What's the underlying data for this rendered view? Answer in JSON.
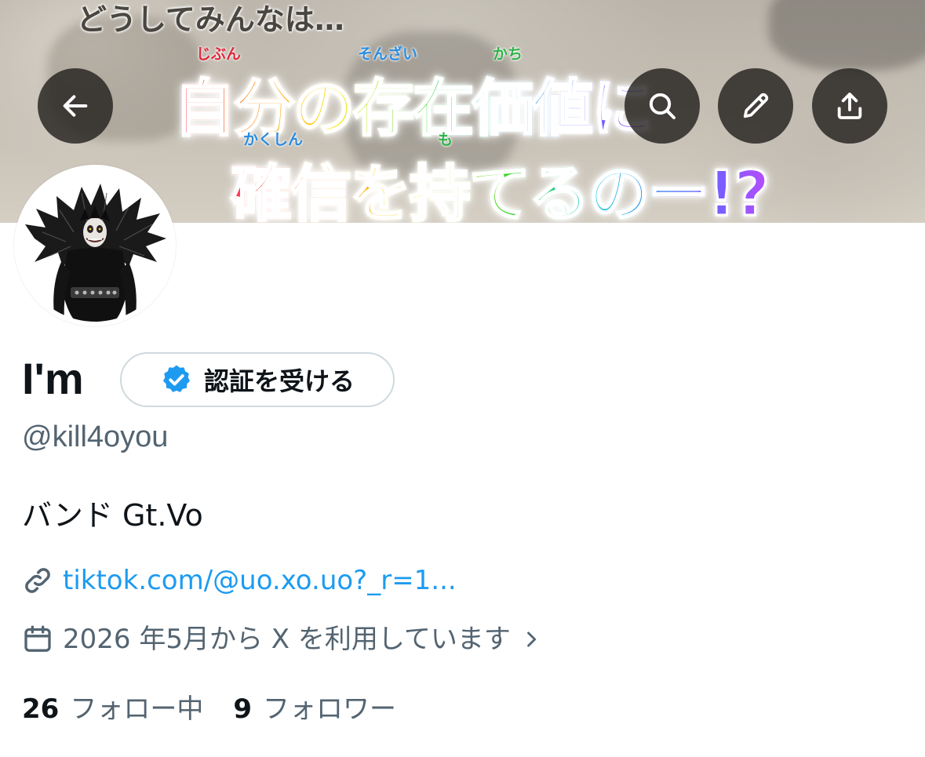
{
  "banner": {
    "caption_top": "どうしてみんなは…",
    "ruby_line1": [
      "じぶん",
      "そんざい",
      "かち"
    ],
    "caption_line1": "自分の存在価値に",
    "ruby_line2": [
      "かくしん",
      "も"
    ],
    "caption_line2": "確信を持てるのー!?"
  },
  "toolbar": {
    "back_icon": "arrow-left-icon",
    "search_icon": "search-icon",
    "edit_icon": "pencil-icon",
    "share_icon": "share-icon"
  },
  "profile": {
    "display_name": "I'm",
    "verify_label": "認証を受ける",
    "handle": "@kill4oyou",
    "bio": "バンド Gt.Vo",
    "link": "tiktok.com/@uo.xo.uo?_r=1...",
    "joined": "2026 年5月から X を利用しています",
    "following_count": "26",
    "following_label": "フォロー中",
    "followers_count": "9",
    "followers_label": "フォロワー"
  },
  "colors": {
    "accent": "#1d9bf0",
    "secondary_text": "#536471",
    "verified_badge": "#1d9bf0"
  }
}
